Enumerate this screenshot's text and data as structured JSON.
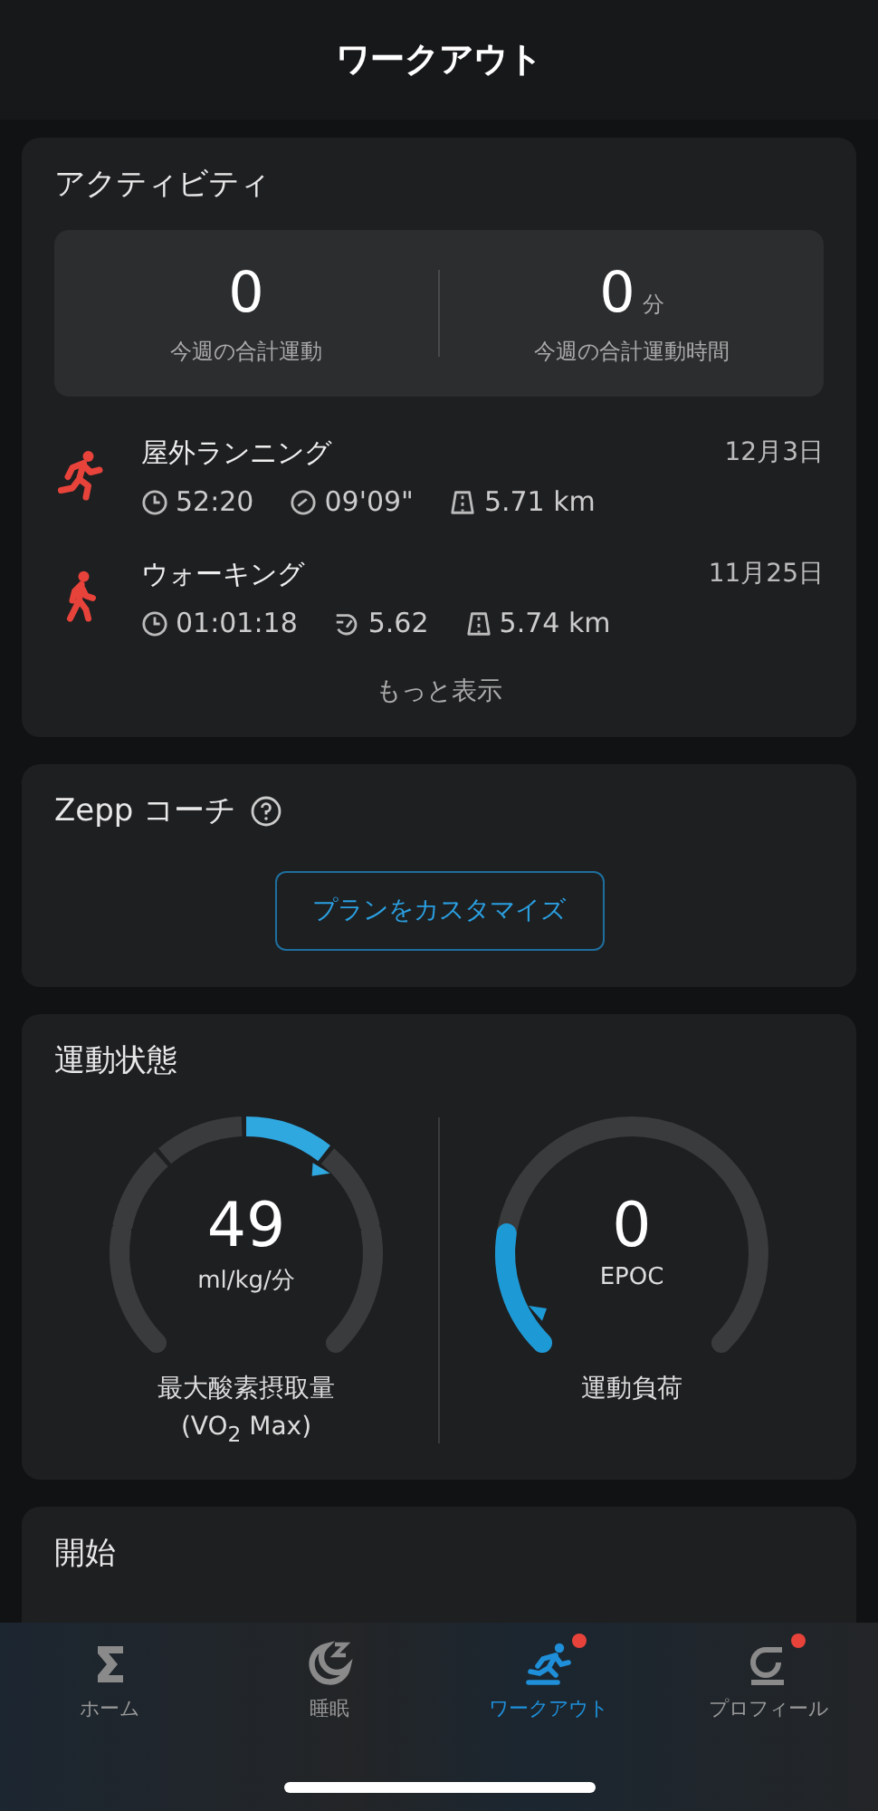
{
  "header": {
    "title": "ワークアウト"
  },
  "activity": {
    "title": "アクティビティ",
    "summary": [
      {
        "value": "0",
        "label": "今週の合計運動"
      },
      {
        "value": "0",
        "unit": "分",
        "label": "今週の合計運動時間"
      }
    ],
    "workouts": [
      {
        "kind": "run",
        "name": "屋外ランニング",
        "date": "12月3日",
        "stats": [
          {
            "kind": "duration",
            "text": "52:20"
          },
          {
            "kind": "pace",
            "text": "09'09\""
          },
          {
            "kind": "distance",
            "text": "5.71 km"
          }
        ]
      },
      {
        "kind": "walk",
        "name": "ウォーキング",
        "date": "11月25日",
        "stats": [
          {
            "kind": "duration",
            "text": "01:01:18"
          },
          {
            "kind": "speed",
            "text": "5.62"
          },
          {
            "kind": "distance",
            "text": "5.74 km"
          }
        ]
      }
    ],
    "more": "もっと表示"
  },
  "coach": {
    "title": "Zepp コーチ",
    "button": "プランをカスタマイズ"
  },
  "status": {
    "title": "運動状態",
    "gauges": [
      {
        "kind": "segmented",
        "value": "49",
        "unit": "ml/kg/分",
        "label": "最大酸素摂取量",
        "sublabel": "(VO$_{2}$ Max)"
      },
      {
        "kind": "fill",
        "value": "0",
        "unit": "EPOC",
        "label": "運動負荷"
      }
    ]
  },
  "start": {
    "title": "開始"
  },
  "tabs": [
    {
      "kind": "home",
      "label": "ホーム",
      "selected": false,
      "badge": false
    },
    {
      "kind": "sleep",
      "label": "睡眠",
      "selected": false,
      "badge": false
    },
    {
      "kind": "workout",
      "label": "ワークアウト",
      "selected": true,
      "badge": true
    },
    {
      "kind": "profile",
      "label": "プロフィール",
      "selected": false,
      "badge": true
    }
  ]
}
